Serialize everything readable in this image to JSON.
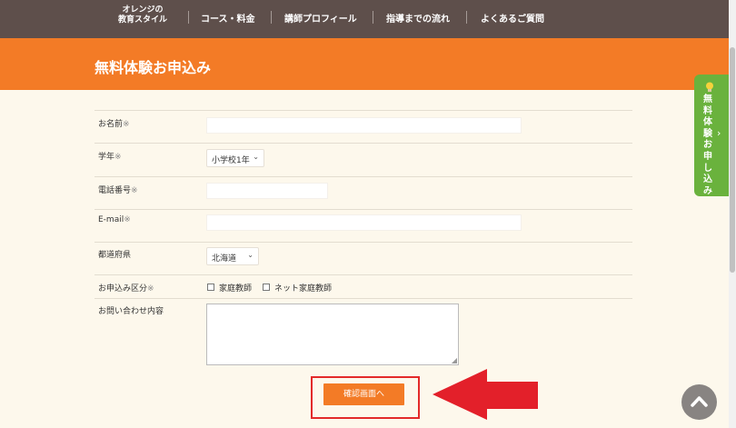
{
  "nav": {
    "brand_line1": "オレンジの",
    "brand_line2": "教育スタイル",
    "items": [
      "コース・料金",
      "講師プロフィール",
      "指導までの流れ",
      "よくあるご質問"
    ]
  },
  "header": {
    "title": "無料体験お申込み"
  },
  "form": {
    "name_label": "お名前",
    "grade_label": "学年",
    "grade_value": "小学校1年",
    "phone_label": "電話番号",
    "email_label": "E-mail",
    "prefecture_label": "都道府県",
    "prefecture_value": "北海道",
    "category_label": "お申込み区分",
    "category_options": [
      "家庭教師",
      "ネット家庭教師"
    ],
    "inquiry_label": "お問い合わせ内容",
    "required_mark": "※"
  },
  "confirm_button": "確認画面へ",
  "side_tab": {
    "label": "無料体験お申し込み"
  },
  "colors": {
    "nav_bg": "#5e4f4b",
    "accent_orange": "#f37b26",
    "side_tab_green": "#6ab23d",
    "highlight_red": "#e32a2a",
    "page_bg": "#fdf8ec"
  },
  "icons": [
    "bulb-icon",
    "chevron-right-icon",
    "chevron-down-icon",
    "arrow-up-icon",
    "resize-handle-icon",
    "red-arrow-annotation"
  ]
}
